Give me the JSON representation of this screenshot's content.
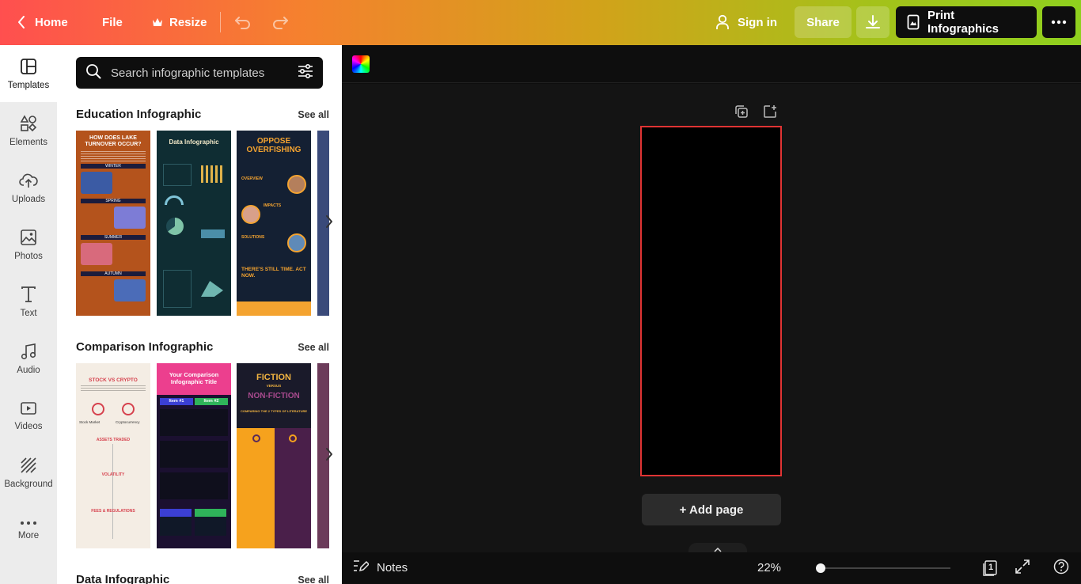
{
  "topbar": {
    "home_label": "Home",
    "file_label": "File",
    "resize_label": "Resize",
    "signin_label": "Sign in",
    "share_label": "Share",
    "print_label": "Print Infographics"
  },
  "nav": {
    "items": [
      {
        "label": "Templates",
        "icon": "templates-icon"
      },
      {
        "label": "Elements",
        "icon": "elements-icon"
      },
      {
        "label": "Uploads",
        "icon": "uploads-icon"
      },
      {
        "label": "Photos",
        "icon": "photos-icon"
      },
      {
        "label": "Text",
        "icon": "text-icon"
      },
      {
        "label": "Audio",
        "icon": "audio-icon"
      },
      {
        "label": "Videos",
        "icon": "videos-icon"
      },
      {
        "label": "Background",
        "icon": "background-icon"
      },
      {
        "label": "More",
        "icon": "more-icon"
      }
    ]
  },
  "search": {
    "placeholder": "Search infographic templates"
  },
  "sections": [
    {
      "title": "Education Infographic",
      "see_all": "See all",
      "templates": [
        {
          "title": "HOW DOES LAKE TURNOVER OCCUR?",
          "sub": [
            "WINTER",
            "SPRING",
            "SUMMER",
            "AUTUMN"
          ]
        },
        {
          "title": "Data Infographic"
        },
        {
          "title": "OPPOSE OVERFISHING",
          "sub": [
            "OVERVIEW",
            "IMPACTS",
            "SOLUTIONS",
            "THERE'S STILL TIME. ACT NOW."
          ]
        }
      ]
    },
    {
      "title": "Comparison Infographic",
      "see_all": "See all",
      "templates": [
        {
          "title": "STOCK VS CRYPTO",
          "sub": [
            "Stock Market",
            "Cryptocurrency",
            "ASSETS TRADED",
            "VOLATILITY",
            "FEES & REGULATIONS"
          ]
        },
        {
          "title": "Your Comparison Infographic Title",
          "sub": [
            "Item #1",
            "Item #2"
          ]
        },
        {
          "title": "FICTION",
          "sub": [
            "VERSUS",
            "NON-FICTION",
            "COMPARING THE 2 TYPES OF LITERATURE"
          ]
        }
      ]
    },
    {
      "title": "Data Infographic",
      "see_all": "See all"
    }
  ],
  "canvas": {
    "add_page_label": "+ Add page"
  },
  "bottombar": {
    "notes_label": "Notes",
    "zoom_label": "22%",
    "zoom_value": 0.0,
    "page_count": "1"
  },
  "colors": {
    "accent_red": "#e03434",
    "panel_bg": "#ffffff",
    "dark": "#0e0e0e"
  }
}
